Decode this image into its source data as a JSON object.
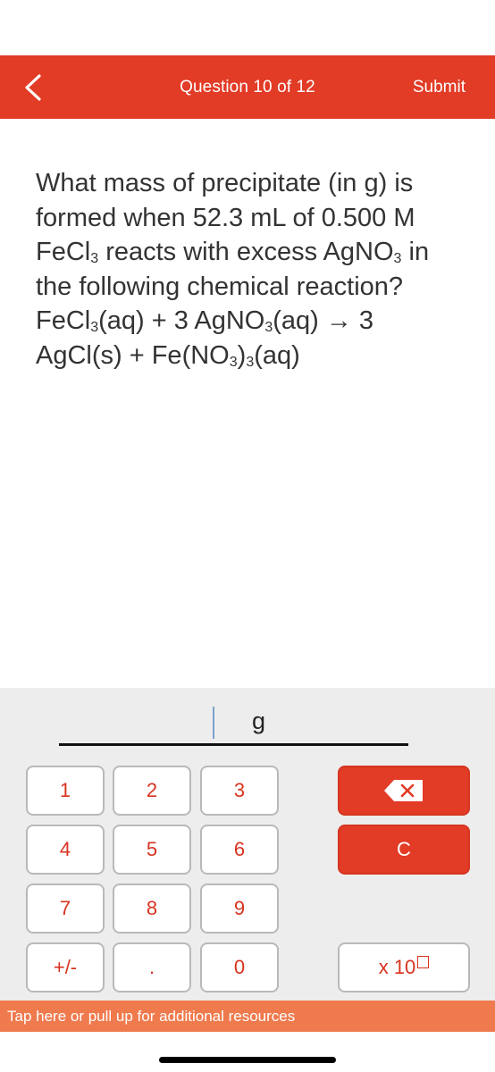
{
  "header": {
    "back_icon": "chevron-left-icon",
    "title": "Question 10 of 12",
    "submit_label": "Submit",
    "color": "#e23b26"
  },
  "question": {
    "lines": [
      "What mass of precipitate (in g) is",
      "formed when 52.3 mL of 0.500 M"
    ],
    "line3": {
      "a": "FeCl",
      "a_sub": "3",
      "b": " reacts with excess AgNO",
      "b_sub": "3",
      "c": " in"
    },
    "line4": "the following chemical reaction?",
    "line5": {
      "a": "FeCl",
      "a_sub": "3",
      "b": "(aq) + 3 AgNO",
      "b_sub": "3",
      "c": "(aq) → 3"
    },
    "line6": {
      "a": "AgCl(s) + Fe(NO",
      "a_sub": "3",
      "b": ")",
      "b_sub": "3",
      "c": "(aq)"
    }
  },
  "answer": {
    "value": "",
    "unit": "g"
  },
  "keypad": {
    "keys": [
      "1",
      "2",
      "3",
      "4",
      "5",
      "6",
      "7",
      "8",
      "9",
      "+/-",
      ".",
      "0"
    ],
    "backspace_icon": "backspace-icon",
    "clear_label": "C",
    "sci_label": "x 10",
    "sci_icon": "exponent-box-icon",
    "accent_color": "#e23b26",
    "digit_color": "#d8331f"
  },
  "resources_bar": {
    "label": "Tap here or pull up for additional resources",
    "color": "#ef7a4d"
  }
}
